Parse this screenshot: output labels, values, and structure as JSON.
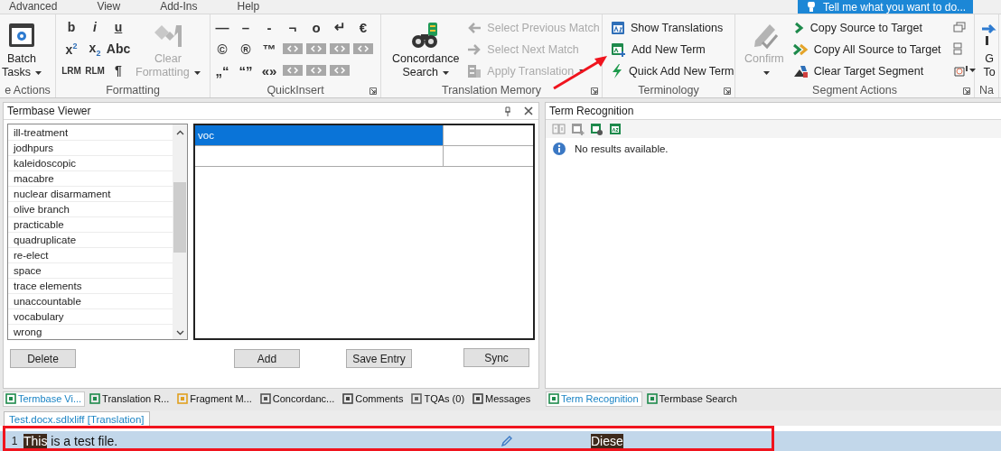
{
  "menu_tabs": [
    {
      "label": "Advanced"
    },
    {
      "label": "View"
    },
    {
      "label": "Add-Ins"
    },
    {
      "label": "Help"
    }
  ],
  "tell_me": {
    "placeholder": "Tell me what you want to do..."
  },
  "ribbon_groups": [
    {
      "label": "e Actions",
      "launcher": false,
      "sections": [
        {
          "kind": "large",
          "items": [
            {
              "label": "Batch\nTasks",
              "dropdown": true,
              "disabled": false
            }
          ]
        }
      ]
    },
    {
      "label": "Formatting",
      "launcher": false,
      "sections": [
        {
          "kind": "glyphs",
          "items": [
            {
              "text": "b"
            },
            {
              "text": "i"
            },
            {
              "text": "u"
            },
            {
              "text": "x$^{2}$"
            },
            {
              "text": "x$_{2}$"
            },
            {
              "text": "Abc"
            },
            {
              "text": "LRM"
            },
            {
              "text": "RLM"
            },
            {
              "text": "¶"
            }
          ]
        },
        {
          "kind": "large",
          "items": [
            {
              "label": "Clear\nFormatting",
              "dropdown": true,
              "disabled": true
            }
          ]
        }
      ]
    },
    {
      "label": "QuickInsert",
      "launcher": true,
      "sections": [
        {
          "kind": "symbols",
          "rows": [
            [
              {
                "kind": "char",
                "text": "—"
              },
              {
                "kind": "char",
                "text": "–"
              },
              {
                "kind": "char",
                "text": "-"
              },
              {
                "kind": "char",
                "text": "¬"
              },
              {
                "kind": "char",
                "text": "o"
              },
              {
                "kind": "char",
                "text": "↵"
              },
              {
                "kind": "char",
                "text": "€"
              }
            ],
            [
              {
                "kind": "char",
                "text": "©"
              },
              {
                "kind": "char",
                "text": "®"
              },
              {
                "kind": "char",
                "text": "™"
              },
              {
                "kind": "tag"
              },
              {
                "kind": "tag"
              },
              {
                "kind": "tag"
              },
              {
                "kind": "tag"
              }
            ],
            [
              {
                "kind": "char",
                "text": "„“"
              },
              {
                "kind": "char",
                "text": "“”"
              },
              {
                "kind": "char",
                "text": "«»"
              },
              {
                "kind": "tag"
              },
              {
                "kind": "tag"
              },
              {
                "kind": "tag"
              }
            ]
          ]
        }
      ]
    },
    {
      "label": "Translation Memory",
      "launcher": true,
      "sections": [
        {
          "kind": "large",
          "items": [
            {
              "label": "Concordance\nSearch",
              "dropdown": true,
              "disabled": false
            }
          ]
        },
        {
          "kind": "small",
          "items": [
            {
              "label": "Select Previous Match",
              "disabled": true,
              "dropdown": false
            },
            {
              "label": "Select Next Match",
              "disabled": true,
              "dropdown": false
            },
            {
              "label": "Apply Translation",
              "disabled": true,
              "dropdown": true
            }
          ]
        }
      ]
    },
    {
      "label": "Terminology",
      "launcher": true,
      "sections": [
        {
          "kind": "small",
          "items": [
            {
              "label": "Show Translations",
              "disabled": false,
              "dropdown": false
            },
            {
              "label": "Add New Term",
              "disabled": false,
              "dropdown": false
            },
            {
              "label": "Quick Add New Term",
              "disabled": false,
              "dropdown": false
            }
          ]
        }
      ]
    },
    {
      "label": "Segment Actions",
      "launcher": true,
      "sections": [
        {
          "kind": "large",
          "items": [
            {
              "label": "Confirm",
              "dropdown": true,
              "disabled": true
            }
          ]
        },
        {
          "kind": "small",
          "items": [
            {
              "label": "Copy Source to Target",
              "disabled": false,
              "dropdown": false
            },
            {
              "label": "Copy All Source to Target",
              "disabled": false,
              "dropdown": false
            },
            {
              "label": "Clear Target Segment",
              "disabled": false,
              "dropdown": false
            }
          ]
        },
        {
          "kind": "side",
          "items": [
            {
              "dropdown": false
            },
            {
              "dropdown": false
            },
            {
              "dropdown": true
            }
          ]
        }
      ]
    },
    {
      "label": "Na",
      "launcher": false,
      "sections": [
        {
          "kind": "large",
          "items": [
            {
              "label": "G\nTo",
              "dropdown": false,
              "disabled": false
            }
          ]
        }
      ]
    }
  ],
  "termbase_viewer": {
    "title": "Termbase Viewer",
    "terms": [
      "ill-treatment",
      "jodhpurs",
      "kaleidoscopic",
      "macabre",
      "nuclear disarmament",
      "olive branch",
      "practicable",
      "quadruplicate",
      "re-elect",
      "space",
      "trace elements",
      "unaccountable",
      "vocabulary",
      "wrong"
    ],
    "entry_rows": [
      {
        "term": "voc",
        "selected": true
      },
      {
        "selected": false
      }
    ],
    "buttons": [
      "Delete",
      "Add",
      "Save Entry",
      "Sync"
    ]
  },
  "term_recognition": {
    "title": "Term Recognition",
    "toolbar": [
      {
        "disabled": true
      },
      {
        "disabled": true
      },
      {
        "disabled": false
      },
      {
        "disabled": false
      }
    ],
    "message": "No results available."
  },
  "left_tabs": [
    {
      "label": "Termbase Vi...",
      "selected": true
    },
    {
      "label": "Translation R...",
      "selected": false
    },
    {
      "label": "Fragment M...",
      "selected": false
    },
    {
      "label": "Concordanc...",
      "selected": false
    },
    {
      "label": "Comments",
      "selected": false
    },
    {
      "label": "TQAs (0)",
      "selected": false
    },
    {
      "label": "Messages",
      "selected": false
    }
  ],
  "right_tabs": [
    {
      "label": "Term Recognition",
      "selected": true
    },
    {
      "label": "Termbase Search",
      "selected": false
    }
  ],
  "document_tab": "Test.docx.sdlxliff [Translation]",
  "segments": [
    {
      "number": "1",
      "source": [
        {
          "text": "This",
          "highlighted": true
        },
        {
          "text": " is a test file.",
          "highlighted": false
        }
      ],
      "edited": true,
      "target": [
        {
          "text": "Diese",
          "highlighted": true
        }
      ]
    }
  ]
}
